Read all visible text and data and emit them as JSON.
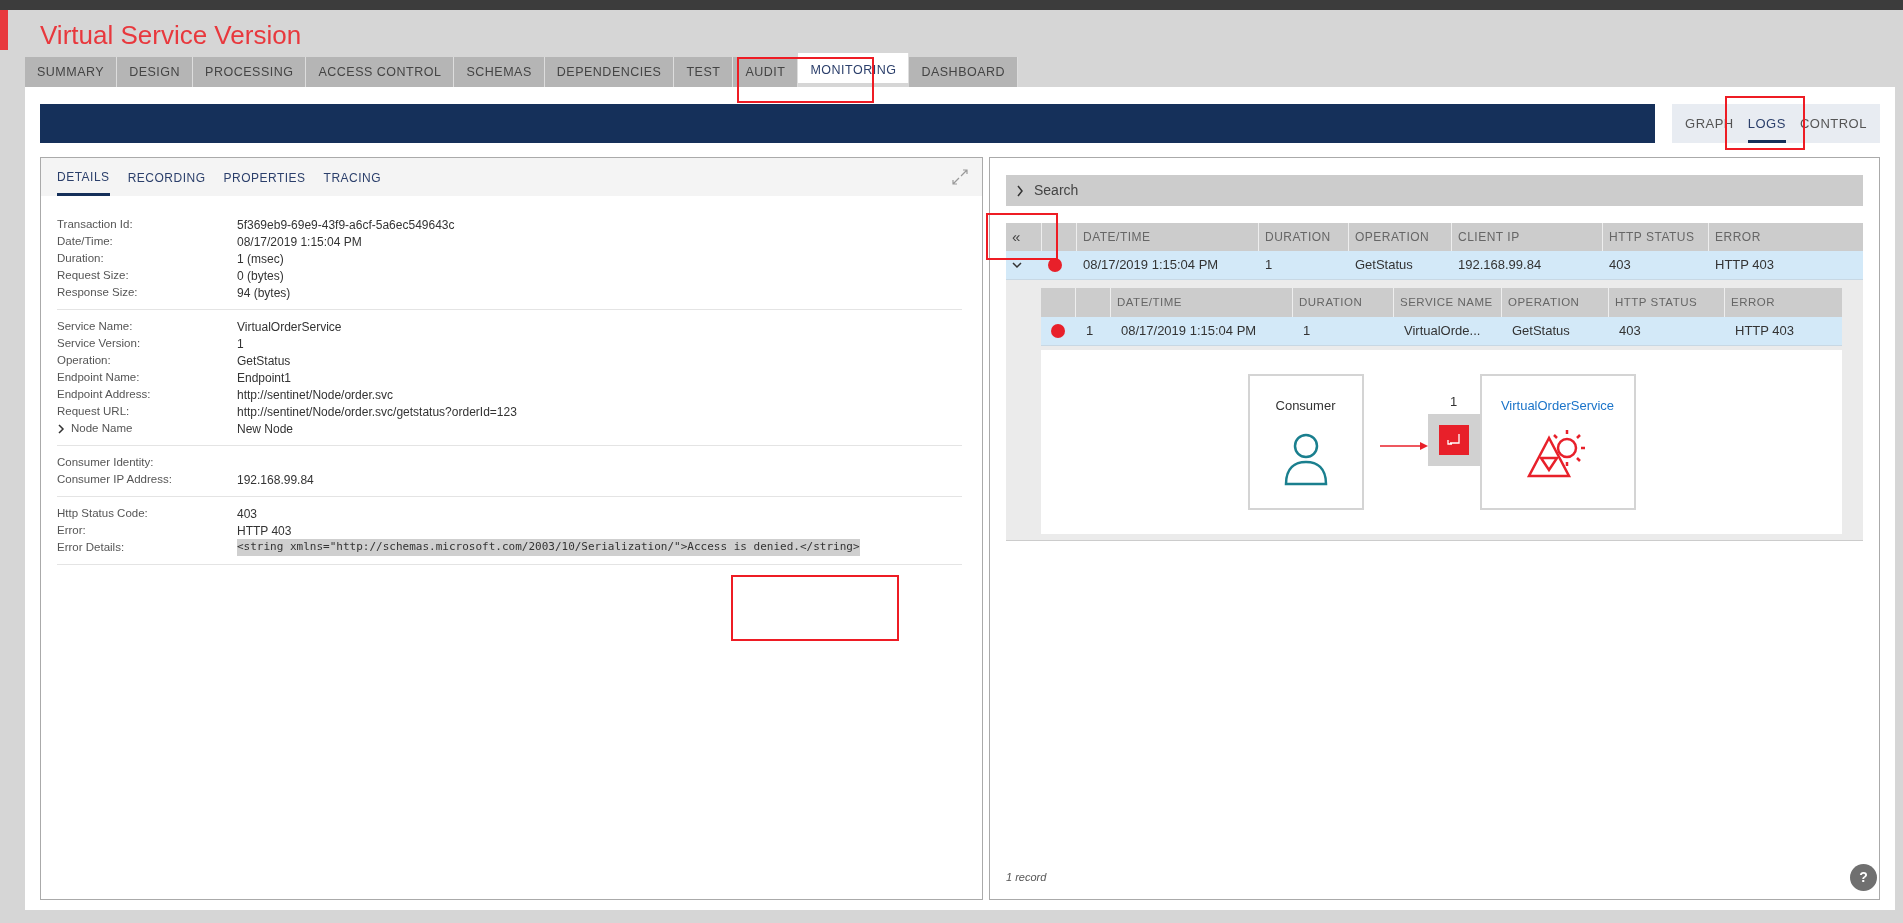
{
  "title": "Virtual Service Version",
  "tabs": [
    {
      "label": "SUMMARY",
      "selected": false
    },
    {
      "label": "DESIGN",
      "selected": false
    },
    {
      "label": "PROCESSING",
      "selected": false
    },
    {
      "label": "ACCESS CONTROL",
      "selected": false
    },
    {
      "label": "SCHEMAS",
      "selected": false
    },
    {
      "label": "DEPENDENCIES",
      "selected": false
    },
    {
      "label": "TEST",
      "selected": false
    },
    {
      "label": "AUDIT",
      "selected": false
    },
    {
      "label": "MONITORING",
      "selected": true
    },
    {
      "label": "DASHBOARD",
      "selected": false
    }
  ],
  "view_tabs": [
    {
      "label": "GRAPH",
      "selected": false
    },
    {
      "label": "LOGS",
      "selected": true
    },
    {
      "label": "CONTROL",
      "selected": false
    }
  ],
  "details": {
    "tabs": [
      {
        "label": "DETAILS",
        "selected": true
      },
      {
        "label": "RECORDING",
        "selected": false
      },
      {
        "label": "PROPERTIES",
        "selected": false
      },
      {
        "label": "TRACING",
        "selected": false
      }
    ],
    "sections": [
      {
        "fields": [
          {
            "label": "Transaction Id:",
            "value": "5f369eb9-69e9-43f9-a6cf-5a6ec549643c"
          },
          {
            "label": "Date/Time:",
            "value": "08/17/2019 1:15:04 PM"
          },
          {
            "label": "Duration:",
            "value": "1 (msec)"
          },
          {
            "label": "Request Size:",
            "value": "0 (bytes)"
          },
          {
            "label": "Response Size:",
            "value": "94 (bytes)"
          }
        ]
      },
      {
        "fields": [
          {
            "label": "Service Name:",
            "value": "VirtualOrderService"
          },
          {
            "label": "Service Version:",
            "value": "1"
          },
          {
            "label": "Operation:",
            "value": "GetStatus"
          },
          {
            "label": "Endpoint Name:",
            "value": "Endpoint1"
          },
          {
            "label": "Endpoint Address:",
            "value": "http://sentinet/Node/order.svc"
          },
          {
            "label": "Request URL:",
            "value": "http://sentinet/Node/order.svc/getstatus?orderId=123"
          },
          {
            "label": "Node Name",
            "value": "New Node",
            "kind": "expander"
          }
        ]
      },
      {
        "fields": [
          {
            "label": "Consumer Identity:"
          },
          {
            "label": "Consumer IP Address:",
            "value": "192.168.99.84"
          }
        ]
      },
      {
        "fields": [
          {
            "label": "Http Status Code:",
            "value": "403"
          },
          {
            "label": "Error:",
            "value": "HTTP 403"
          },
          {
            "label": "Error Details:",
            "value": "<string xmlns=\"http://schemas.microsoft.com/2003/10/Serialization/\">Access is denied.</string>",
            "kind": "code"
          }
        ]
      }
    ]
  },
  "logs": {
    "search": "Search",
    "collapse_icon": "«",
    "columns": [
      "DATE/TIME",
      "DURATION",
      "OPERATION",
      "CLIENT IP",
      "HTTP STATUS",
      "ERROR"
    ],
    "rows": [
      {
        "expanded": true,
        "color": "#e8202a",
        "cells": [
          "08/17/2019 1:15:04 PM",
          "1",
          "GetStatus",
          "192.168.99.84",
          "403",
          "HTTP 403"
        ]
      }
    ],
    "sub_columns": [
      "DATE/TIME",
      "DURATION",
      "SERVICE NAME",
      "OPERATION",
      "HTTP STATUS",
      "ERROR"
    ],
    "sub_rows": [
      {
        "color": "#e8202a",
        "index": "1",
        "cells": [
          "08/17/2019 1:15:04 PM",
          "1",
          "VirtualOrde...",
          "GetStatus",
          "403",
          "HTTP 403"
        ]
      }
    ],
    "diagram": {
      "consumer": "Consumer",
      "count": "1",
      "service": "VirtualOrderService"
    },
    "footer": "1 record",
    "help": "?"
  }
}
